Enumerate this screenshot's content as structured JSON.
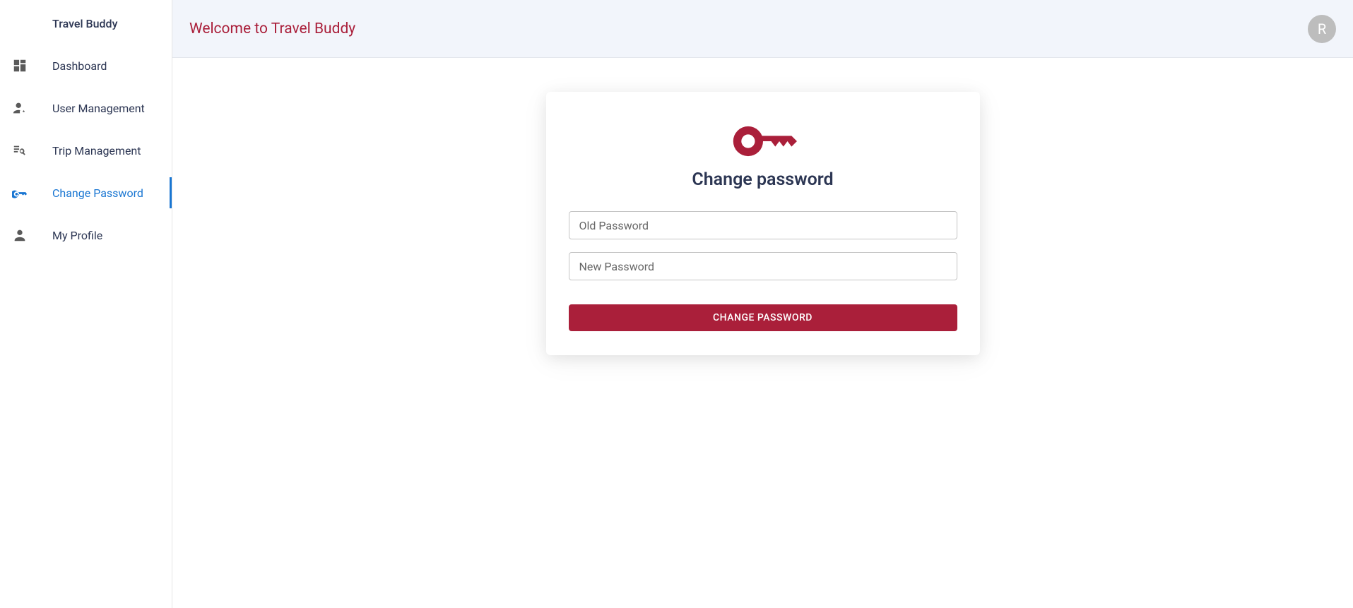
{
  "brand": "Travel Buddy",
  "sidebar": {
    "items": [
      {
        "label": "Dashboard",
        "icon": "dashboard"
      },
      {
        "label": "User Management",
        "icon": "user-gear"
      },
      {
        "label": "Trip Management",
        "icon": "list-search"
      },
      {
        "label": "Change Password",
        "icon": "key",
        "active": true
      },
      {
        "label": "My Profile",
        "icon": "person"
      }
    ]
  },
  "topbar": {
    "title": "Welcome to Travel Buddy",
    "avatar_letter": "R"
  },
  "card": {
    "title": "Change password",
    "old_password_placeholder": "Old Password",
    "new_password_placeholder": "New Password",
    "submit_label": "CHANGE PASSWORD"
  }
}
